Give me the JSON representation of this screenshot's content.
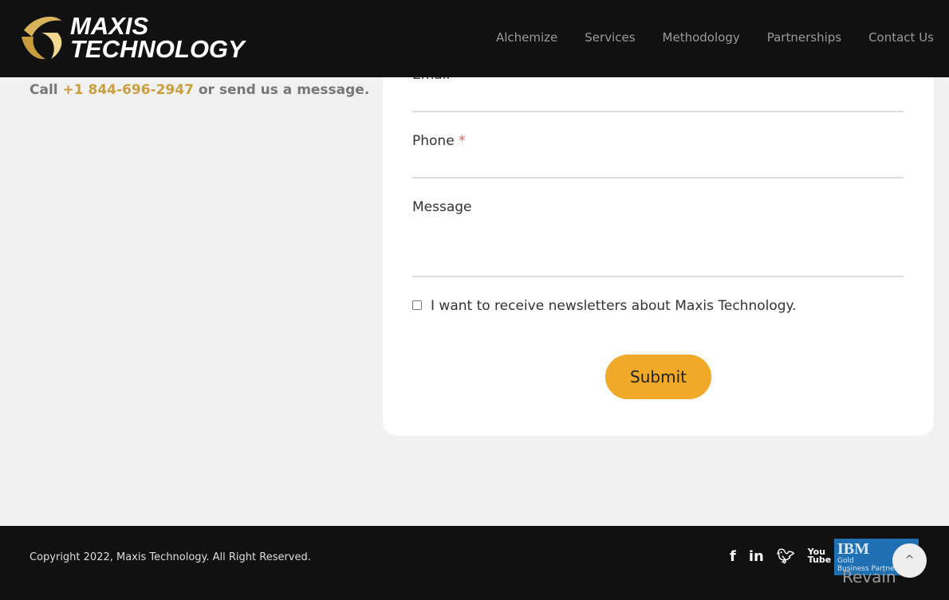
{
  "header": {
    "logo_line1": "MAXIS",
    "logo_line2": "TECHNOLOGY",
    "nav": [
      "Alchemize",
      "Services",
      "Methodology",
      "Partnerships",
      "Contact Us"
    ]
  },
  "contact": {
    "call_prefix": "Call ",
    "phone": "+1 844-696-2947",
    "call_suffix": " or send us a message."
  },
  "form": {
    "email_label": "Email",
    "phone_label": "Phone",
    "required_mark": "*",
    "message_label": "Message",
    "newsletter_label": "I want to receive newsletters about Maxis Technology.",
    "newsletter_checked": false,
    "submit_label": "Submit"
  },
  "footer": {
    "copyright": "Copyright 2022, Maxis Technology. All Right Reserved.",
    "social": [
      "facebook-icon",
      "linkedin-icon",
      "twitter-icon",
      "youtube-icon"
    ],
    "ibm_badge": {
      "brand": "IBM",
      "line1": "Gold",
      "line2": "Business Partner"
    },
    "watermark": "Revain"
  },
  "colors": {
    "accent": "#f0a928",
    "phone": "#c9a040",
    "header_bg": "#111111"
  }
}
